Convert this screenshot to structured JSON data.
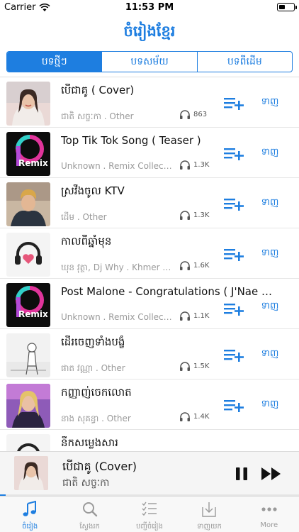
{
  "status_bar": {
    "carrier": "Carrier",
    "time": "11:53 PM"
  },
  "nav": {
    "title": "ចំរៀងខ្មែរ"
  },
  "segments": [
    {
      "label": "បទថ្មីៗ",
      "active": true
    },
    {
      "label": "បទសម័យ",
      "active": false
    },
    {
      "label": "បទពីដើម",
      "active": false
    }
  ],
  "songs": [
    {
      "title": "បើជាគូ ( Cover)",
      "meta": "ជាតិ សច្ចៈកា . Other",
      "listens": "863",
      "download": "ទាញ",
      "thumb": "portrait-woman"
    },
    {
      "title": "Top Tik Tok Song ( Teaser )",
      "meta": "Unknown . Remix Collection",
      "listens": "1.3K",
      "download": "ទាញ",
      "thumb": "remix-logo"
    },
    {
      "title": "ស្រវឹងចូល KTV",
      "meta": "ដើម . Other",
      "listens": "1.3K",
      "download": "ទាញ",
      "thumb": "portrait-man"
    },
    {
      "title": "កាលពីឆ្នាំមុន",
      "meta": "ឃុន វុត្ថា, Dj Why . Khmer Original Song",
      "listens": "1.6K",
      "download": "ទាញ",
      "thumb": "headphones-heart"
    },
    {
      "title": "Post Malone - Congratulations ( J'Nae Morrae Remix )",
      "meta": "Unknown . Remix Collection",
      "listens": "1.1K",
      "download": "ទាញ",
      "thumb": "remix-logo"
    },
    {
      "title": "ដើរចេញទាំងបង្ខំ",
      "meta": "ផាត វណ្ណា . Other",
      "listens": "1.5K",
      "download": "ទាញ",
      "thumb": "sketch"
    },
    {
      "title": "កញ្ញាញ់ចេកលោត",
      "meta": "នាង សុគន្ធា . Other",
      "listens": "1.4K",
      "download": "ទាញ",
      "thumb": "portrait-purple"
    },
    {
      "title": "នឹកសម្លេងសារ",
      "meta": "",
      "listens": "",
      "download": "",
      "thumb": "headphones"
    }
  ],
  "now_playing": {
    "title": "បើជាគូ (Cover)",
    "artist": "ជាតិ សច្ចៈកា",
    "progress": 0.02
  },
  "tabs": [
    {
      "label": "ចំរៀង",
      "icon": "music-note-icon",
      "active": true
    },
    {
      "label": "ស្វែងរក",
      "icon": "search-icon",
      "active": false
    },
    {
      "label": "បញ្ជីចំរៀង",
      "icon": "checklist-icon",
      "active": false
    },
    {
      "label": "ទាញយក",
      "icon": "download-tray-icon",
      "active": false
    },
    {
      "label": "More",
      "icon": "more-dots-icon",
      "active": false
    }
  ],
  "colors": {
    "accent": "#1e7ee0",
    "muted_text": "#9a9a9a"
  }
}
